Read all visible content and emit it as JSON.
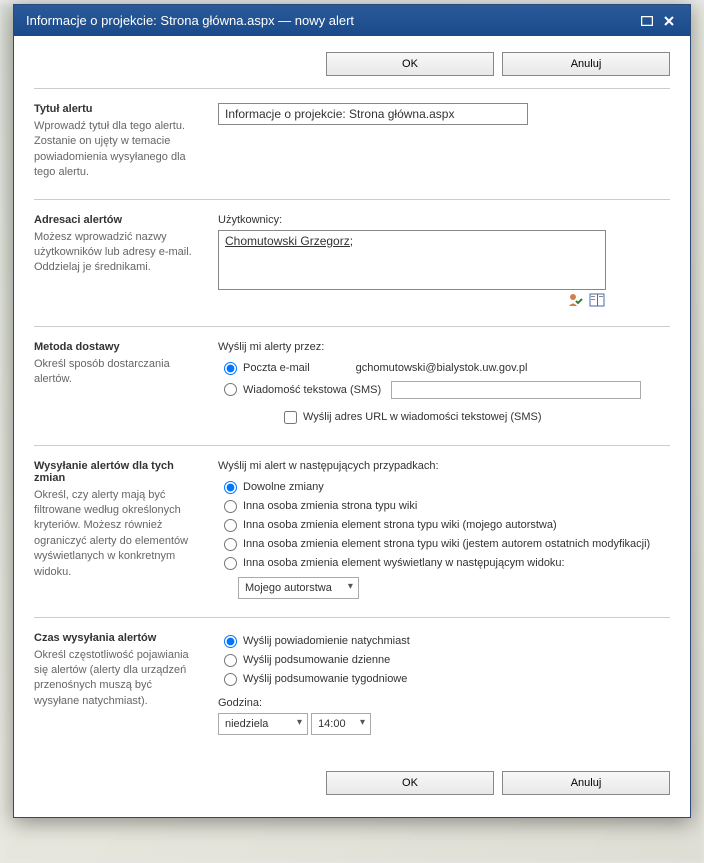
{
  "titlebar": {
    "text": "Informacje o projekcie: Strona główna.aspx — nowy alert"
  },
  "buttons": {
    "ok": "OK",
    "cancel": "Anuluj"
  },
  "sections": {
    "title_section": {
      "heading": "Tytuł alertu",
      "desc": "Wprowadź tytuł dla tego alertu. Zostanie on ujęty w temacie powiadomienia wysyłanego dla tego alertu.",
      "value": "Informacje o projekcie: Strona główna.aspx"
    },
    "recipients": {
      "heading": "Adresaci alertów",
      "desc": "Możesz wprowadzić nazwy użytkowników lub adresy e-mail. Oddzielaj je średnikami.",
      "label": "Użytkownicy:",
      "value": "Chomutowski Grzegorz;"
    },
    "delivery": {
      "heading": "Metoda dostawy",
      "desc": "Określ sposób dostarczania alertów.",
      "label": "Wyślij mi alerty przez:",
      "email_label": "Poczta e-mail",
      "email_value": "gchomutowski@bialystok.uw.gov.pl",
      "sms_label": "Wiadomość tekstowa (SMS)",
      "sms_url_label": "Wyślij adres URL w wiadomości tekstowej (SMS)"
    },
    "changes": {
      "heading": "Wysyłanie alertów dla tych zmian",
      "desc": "Określ, czy alerty mają być filtrowane według określonych kryteriów. Możesz również ograniczyć alerty do elementów wyświetlanych w konkretnym widoku.",
      "label": "Wyślij mi alert w następujących przypadkach:",
      "opt1": "Dowolne zmiany",
      "opt2": "Inna osoba zmienia strona typu wiki",
      "opt3": "Inna osoba zmienia element strona typu wiki (mojego autorstwa)",
      "opt4": "Inna osoba zmienia element strona typu wiki (jestem autorem ostatnich modyfikacji)",
      "opt5": "Inna osoba zmienia element wyświetlany w następującym widoku:",
      "view_select": "Mojego autorstwa"
    },
    "timing": {
      "heading": "Czas wysyłania alertów",
      "desc": "Określ częstotliwość pojawiania się alertów (alerty dla urządzeń przenośnych muszą być wysyłane natychmiast).",
      "opt1": "Wyślij powiadomienie natychmiast",
      "opt2": "Wyślij podsumowanie dzienne",
      "opt3": "Wyślij podsumowanie tygodniowe",
      "hour_label": "Godzina:",
      "day_value": "niedziela",
      "time_value": "14:00"
    }
  }
}
